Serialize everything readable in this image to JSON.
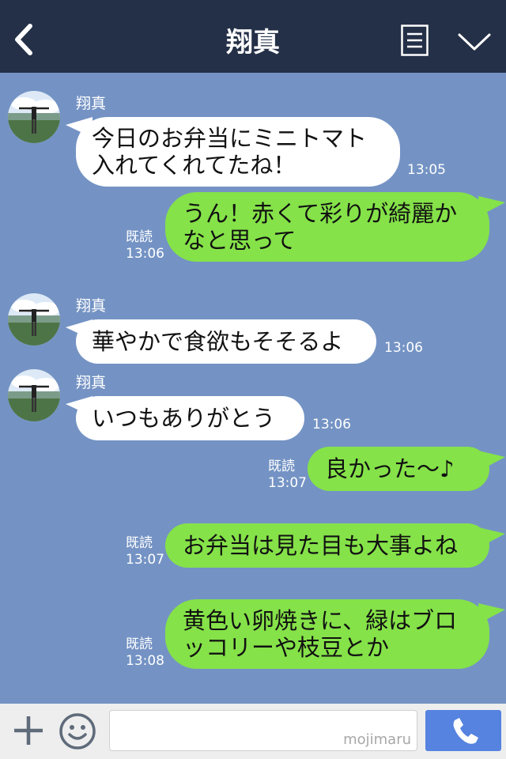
{
  "header": {
    "title": "翔真"
  },
  "messages": [
    {
      "sender": "翔真",
      "lines": [
        "今日のお弁当にミニトマト",
        "入れてくれてたね！"
      ],
      "time": "13:05"
    },
    {
      "read": "既読",
      "time": "13:06",
      "lines": [
        "うん！赤くて彩りが綺麗か",
        "なと思って"
      ]
    },
    {
      "sender": "翔真",
      "lines": [
        "華やかで食欲もそそるよ"
      ],
      "time": "13:06"
    },
    {
      "sender": "翔真",
      "lines": [
        "いつもありがとう"
      ],
      "time": "13:06"
    },
    {
      "read": "既読",
      "time": "13:07",
      "lines": [
        "良かった～♪"
      ]
    },
    {
      "read": "既読",
      "time": "13:07",
      "lines": [
        "お弁当は見た目も大事よね"
      ]
    },
    {
      "read": "既読",
      "time": "13:08",
      "lines": [
        "黄色い卵焼きに、緑はブロ",
        "ッコリーや枝豆とか"
      ]
    }
  ],
  "input": {
    "placeholder": ""
  },
  "watermark": "mojimaru",
  "colors": {
    "header": "#243047",
    "background": "#7493c4",
    "outgoing": "#85e249",
    "incoming": "#ffffff",
    "send": "#5583df"
  }
}
